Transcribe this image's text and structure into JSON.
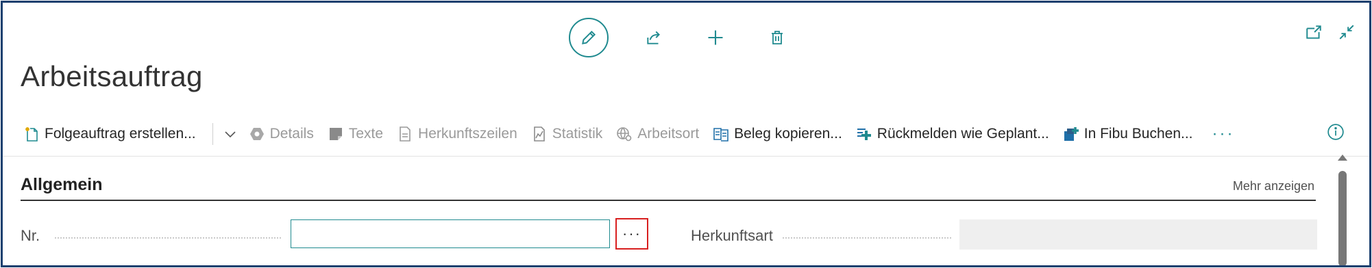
{
  "page": {
    "title": "Arbeitsauftrag"
  },
  "top_actions": [
    {
      "name": "edit-icon"
    },
    {
      "name": "share-icon"
    },
    {
      "name": "add-icon"
    },
    {
      "name": "delete-icon"
    }
  ],
  "window_actions": [
    {
      "name": "open-new-window-icon"
    },
    {
      "name": "collapse-icon"
    }
  ],
  "action_bar": {
    "items": [
      {
        "label": "Folgeauftrag erstellen...",
        "icon": "new-document-icon",
        "enabled": true
      },
      {
        "label": "Details",
        "icon": "hexagon-icon",
        "enabled": false
      },
      {
        "label": "Texte",
        "icon": "note-icon",
        "enabled": false
      },
      {
        "label": "Herkunftszeilen",
        "icon": "document-lines-icon",
        "enabled": false
      },
      {
        "label": "Statistik",
        "icon": "chart-icon",
        "enabled": true
      },
      {
        "label": "Arbeitsort",
        "icon": "globe-gear-icon",
        "enabled": false
      },
      {
        "label": "Beleg kopieren...",
        "icon": "copy-document-icon",
        "enabled": true
      },
      {
        "label": "Rückmelden wie Geplant...",
        "icon": "post-lines-icon",
        "enabled": true
      },
      {
        "label": "In Fibu Buchen...",
        "icon": "post-ledger-icon",
        "enabled": true
      }
    ],
    "more_label": "···"
  },
  "section": {
    "title": "Allgemein",
    "show_more_label": "Mehr anzeigen"
  },
  "fields": {
    "nr": {
      "label": "Nr.",
      "value": "",
      "assist_label": "···"
    },
    "herkunftsart": {
      "label": "Herkunftsart",
      "value": ""
    }
  },
  "colors": {
    "accent": "#1f8a8f",
    "frame": "#1c3f6e",
    "highlight": "#d81e1e"
  }
}
